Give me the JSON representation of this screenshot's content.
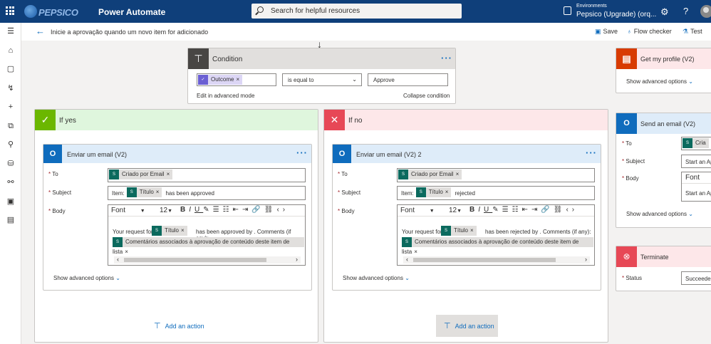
{
  "topbar": {
    "brand": "PEPSICO",
    "app": "Power Automate",
    "search_placeholder": "Search for helpful resources",
    "env_label": "Environments",
    "env_name": "Pepsico (Upgrade) (orq...",
    "help": "?",
    "gear": "⚙"
  },
  "commandbar": {
    "flow_title": "Inicie a aprovação quando um novo item for adicionado",
    "save": "Save",
    "flow_checker": "Flow checker",
    "test": "Test"
  },
  "condition": {
    "title": "Condition",
    "left_token": "Outcome",
    "operator": "is equal to",
    "right_value": "Approve",
    "edit_advanced": "Edit in advanced mode",
    "collapse": "Collapse condition"
  },
  "branch_yes": {
    "title": "If yes",
    "action_title": "Enviar um email (V2)",
    "to_label": "To",
    "to_token": "Criado por Email",
    "subject_label": "Subject",
    "subject_prefix": "Item:",
    "subject_token": "Título",
    "subject_suffix": "has been approved",
    "body_label": "Body",
    "font": "Font",
    "size": "12",
    "body_prefix": "Your request for",
    "body_token": "Título",
    "body_suffix": "has been approved by . Comments (if any):",
    "body_token2": "Comentários associados à aprovação de conteúdo deste item de lista",
    "advanced": "Show advanced options",
    "add_action": "Add an action"
  },
  "branch_no": {
    "title": "If no",
    "action_title": "Enviar um email (V2) 2",
    "to_label": "To",
    "to_token": "Criado por Email",
    "subject_label": "Subject",
    "subject_prefix": "Item:",
    "subject_token": "Título",
    "subject_suffix": "rejected",
    "body_label": "Body",
    "font": "Font",
    "size": "12",
    "body_prefix": "Your request for",
    "body_token": "Título",
    "body_suffix": "has been rejected by . Comments (if any):",
    "body_token2": "Comentários associados à aprovação de conteúdo deste item de lista",
    "advanced": "Show advanced options",
    "add_action": "Add an action"
  },
  "right_panel": {
    "profile": {
      "title": "Get my profile (V2)",
      "advanced": "Show advanced options"
    },
    "email": {
      "title": "Send an email (V2)",
      "to_label": "To",
      "to_value": "Cria",
      "subject_label": "Subject",
      "subject_value": "Start an Ap",
      "body_label": "Body",
      "font": "Font",
      "body_value": "Start an Ap",
      "advanced": "Show advanced options"
    },
    "terminate": {
      "title": "Terminate",
      "status_label": "Status",
      "status_value": "Succeeded"
    }
  },
  "colors": {
    "topbar": "#0f3f7a",
    "accent": "#0f6cbd",
    "yes_green": "#6bb700",
    "no_red": "#e74856",
    "outlook_blue": "#0f6cbd",
    "office_orange": "#d83b01"
  }
}
